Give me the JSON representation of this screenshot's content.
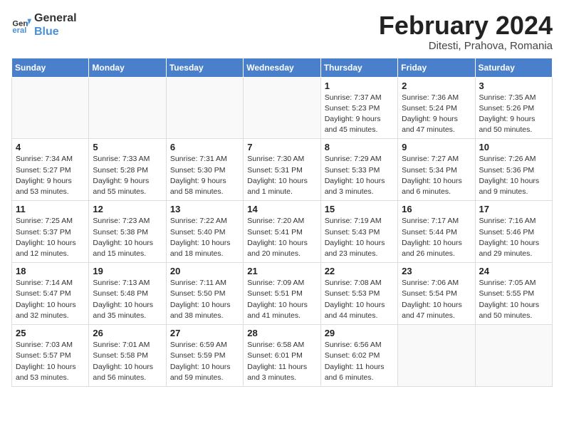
{
  "logo": {
    "text_general": "General",
    "text_blue": "Blue"
  },
  "header": {
    "title": "February 2024",
    "subtitle": "Ditesti, Prahova, Romania"
  },
  "weekdays": [
    "Sunday",
    "Monday",
    "Tuesday",
    "Wednesday",
    "Thursday",
    "Friday",
    "Saturday"
  ],
  "weeks": [
    [
      {
        "day": "",
        "detail": ""
      },
      {
        "day": "",
        "detail": ""
      },
      {
        "day": "",
        "detail": ""
      },
      {
        "day": "",
        "detail": ""
      },
      {
        "day": "1",
        "detail": "Sunrise: 7:37 AM\nSunset: 5:23 PM\nDaylight: 9 hours\nand 45 minutes."
      },
      {
        "day": "2",
        "detail": "Sunrise: 7:36 AM\nSunset: 5:24 PM\nDaylight: 9 hours\nand 47 minutes."
      },
      {
        "day": "3",
        "detail": "Sunrise: 7:35 AM\nSunset: 5:26 PM\nDaylight: 9 hours\nand 50 minutes."
      }
    ],
    [
      {
        "day": "4",
        "detail": "Sunrise: 7:34 AM\nSunset: 5:27 PM\nDaylight: 9 hours\nand 53 minutes."
      },
      {
        "day": "5",
        "detail": "Sunrise: 7:33 AM\nSunset: 5:28 PM\nDaylight: 9 hours\nand 55 minutes."
      },
      {
        "day": "6",
        "detail": "Sunrise: 7:31 AM\nSunset: 5:30 PM\nDaylight: 9 hours\nand 58 minutes."
      },
      {
        "day": "7",
        "detail": "Sunrise: 7:30 AM\nSunset: 5:31 PM\nDaylight: 10 hours\nand 1 minute."
      },
      {
        "day": "8",
        "detail": "Sunrise: 7:29 AM\nSunset: 5:33 PM\nDaylight: 10 hours\nand 3 minutes."
      },
      {
        "day": "9",
        "detail": "Sunrise: 7:27 AM\nSunset: 5:34 PM\nDaylight: 10 hours\nand 6 minutes."
      },
      {
        "day": "10",
        "detail": "Sunrise: 7:26 AM\nSunset: 5:36 PM\nDaylight: 10 hours\nand 9 minutes."
      }
    ],
    [
      {
        "day": "11",
        "detail": "Sunrise: 7:25 AM\nSunset: 5:37 PM\nDaylight: 10 hours\nand 12 minutes."
      },
      {
        "day": "12",
        "detail": "Sunrise: 7:23 AM\nSunset: 5:38 PM\nDaylight: 10 hours\nand 15 minutes."
      },
      {
        "day": "13",
        "detail": "Sunrise: 7:22 AM\nSunset: 5:40 PM\nDaylight: 10 hours\nand 18 minutes."
      },
      {
        "day": "14",
        "detail": "Sunrise: 7:20 AM\nSunset: 5:41 PM\nDaylight: 10 hours\nand 20 minutes."
      },
      {
        "day": "15",
        "detail": "Sunrise: 7:19 AM\nSunset: 5:43 PM\nDaylight: 10 hours\nand 23 minutes."
      },
      {
        "day": "16",
        "detail": "Sunrise: 7:17 AM\nSunset: 5:44 PM\nDaylight: 10 hours\nand 26 minutes."
      },
      {
        "day": "17",
        "detail": "Sunrise: 7:16 AM\nSunset: 5:46 PM\nDaylight: 10 hours\nand 29 minutes."
      }
    ],
    [
      {
        "day": "18",
        "detail": "Sunrise: 7:14 AM\nSunset: 5:47 PM\nDaylight: 10 hours\nand 32 minutes."
      },
      {
        "day": "19",
        "detail": "Sunrise: 7:13 AM\nSunset: 5:48 PM\nDaylight: 10 hours\nand 35 minutes."
      },
      {
        "day": "20",
        "detail": "Sunrise: 7:11 AM\nSunset: 5:50 PM\nDaylight: 10 hours\nand 38 minutes."
      },
      {
        "day": "21",
        "detail": "Sunrise: 7:09 AM\nSunset: 5:51 PM\nDaylight: 10 hours\nand 41 minutes."
      },
      {
        "day": "22",
        "detail": "Sunrise: 7:08 AM\nSunset: 5:53 PM\nDaylight: 10 hours\nand 44 minutes."
      },
      {
        "day": "23",
        "detail": "Sunrise: 7:06 AM\nSunset: 5:54 PM\nDaylight: 10 hours\nand 47 minutes."
      },
      {
        "day": "24",
        "detail": "Sunrise: 7:05 AM\nSunset: 5:55 PM\nDaylight: 10 hours\nand 50 minutes."
      }
    ],
    [
      {
        "day": "25",
        "detail": "Sunrise: 7:03 AM\nSunset: 5:57 PM\nDaylight: 10 hours\nand 53 minutes."
      },
      {
        "day": "26",
        "detail": "Sunrise: 7:01 AM\nSunset: 5:58 PM\nDaylight: 10 hours\nand 56 minutes."
      },
      {
        "day": "27",
        "detail": "Sunrise: 6:59 AM\nSunset: 5:59 PM\nDaylight: 10 hours\nand 59 minutes."
      },
      {
        "day": "28",
        "detail": "Sunrise: 6:58 AM\nSunset: 6:01 PM\nDaylight: 11 hours\nand 3 minutes."
      },
      {
        "day": "29",
        "detail": "Sunrise: 6:56 AM\nSunset: 6:02 PM\nDaylight: 11 hours\nand 6 minutes."
      },
      {
        "day": "",
        "detail": ""
      },
      {
        "day": "",
        "detail": ""
      }
    ]
  ]
}
